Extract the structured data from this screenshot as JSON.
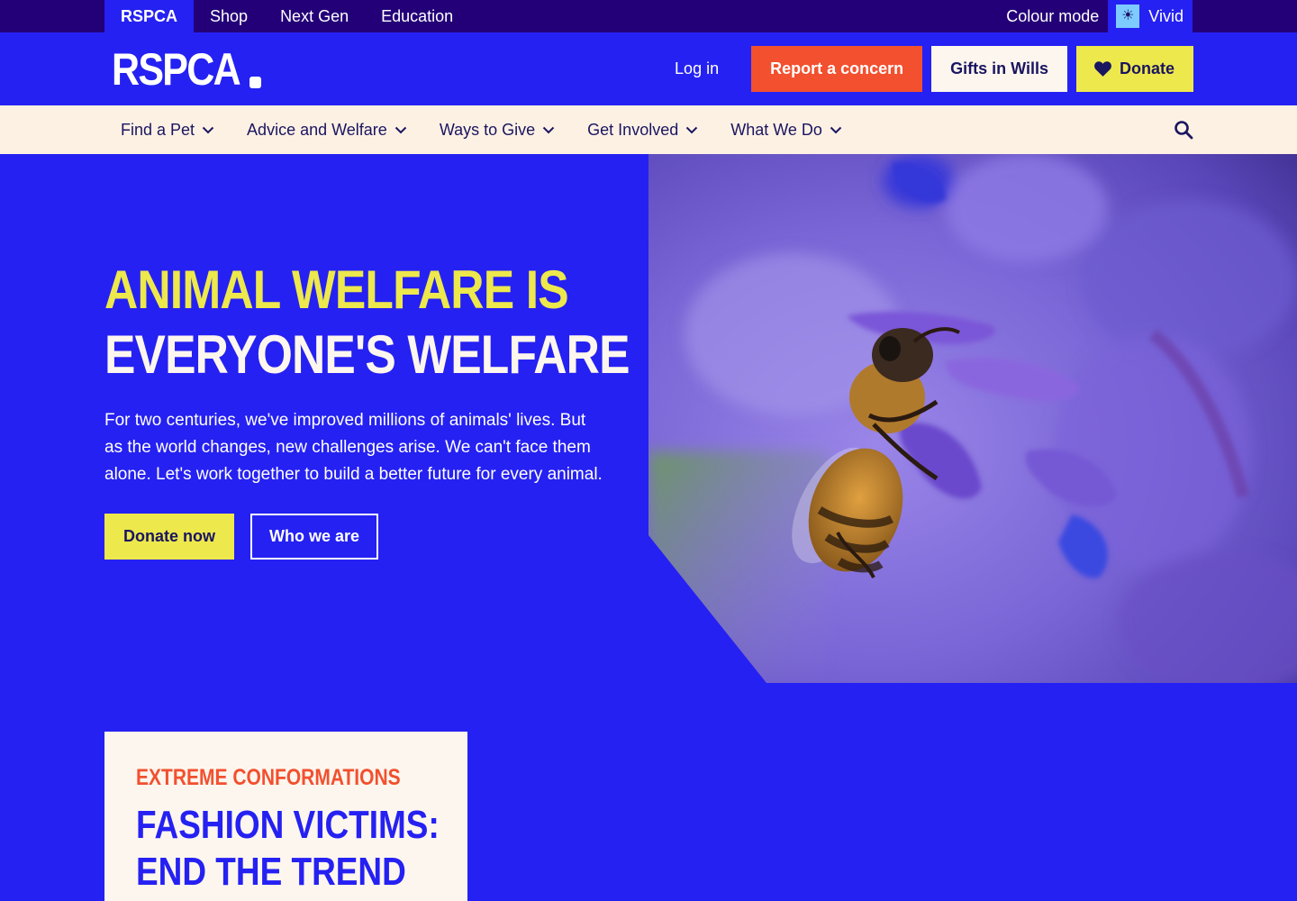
{
  "topbar": {
    "sites": [
      {
        "label": "RSPCA",
        "active": true
      },
      {
        "label": "Shop",
        "active": false
      },
      {
        "label": "Next Gen",
        "active": false
      },
      {
        "label": "Education",
        "active": false
      }
    ],
    "colour_mode_label": "Colour mode",
    "colour_mode_value": "Vivid",
    "colour_mode_icon": "sun-icon"
  },
  "header": {
    "logo_text": "RSPCA",
    "login_label": "Log in",
    "report_label": "Report a concern",
    "gifts_label": "Gifts in Wills",
    "donate_label": "Donate",
    "donate_icon": "heart-icon"
  },
  "nav": {
    "items": [
      {
        "label": "Find a Pet"
      },
      {
        "label": "Advice and Welfare"
      },
      {
        "label": "Ways to Give"
      },
      {
        "label": "Get Involved"
      },
      {
        "label": "What We Do"
      }
    ],
    "search_icon": "search-icon"
  },
  "hero": {
    "title_line1": "Animal welfare is",
    "title_line2": "everyone's welfare",
    "text": "For two centuries, we've improved millions of animals' lives. But as the world changes, new challenges arise. We can't face them alone. Let's work together to build a better future for every animal.",
    "primary_button": "Donate now",
    "secondary_button": "Who we are",
    "image_subject": "honeybee on purple flower"
  },
  "feature": {
    "eyebrow": "Extreme conformations",
    "title_line1": "Fashion victims:",
    "title_line2": "End the trend"
  },
  "colors": {
    "brand_blue": "#2521f2",
    "topbar_purple": "#230078",
    "accent_yellow": "#ede84c",
    "accent_orange": "#f2502f",
    "cream": "#fdf6ee",
    "nav_cream": "#fdf1e4",
    "navy_text": "#1a1560"
  }
}
